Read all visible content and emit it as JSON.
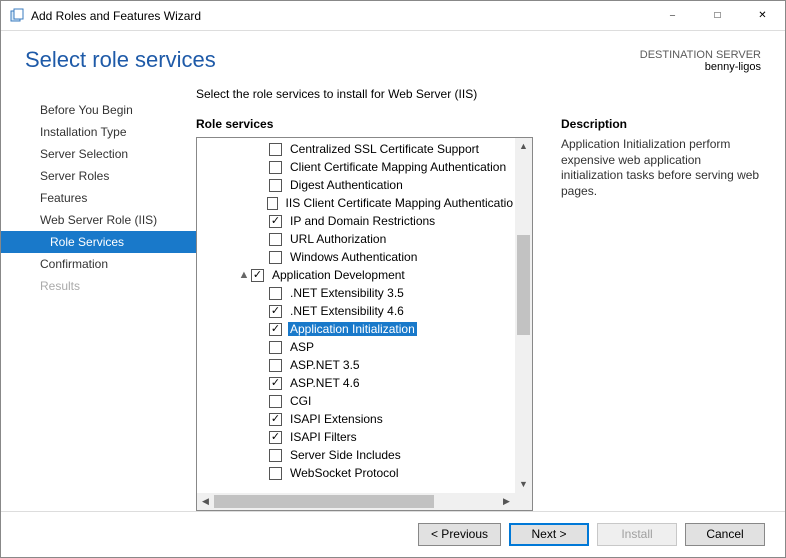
{
  "window": {
    "title": "Add Roles and Features Wizard"
  },
  "header": {
    "page_title": "Select role services",
    "destination_label": "DESTINATION SERVER",
    "destination_value": "benny-ligos"
  },
  "sidebar": {
    "items": [
      {
        "label": "Before You Begin"
      },
      {
        "label": "Installation Type"
      },
      {
        "label": "Server Selection"
      },
      {
        "label": "Server Roles"
      },
      {
        "label": "Features"
      },
      {
        "label": "Web Server Role (IIS)"
      },
      {
        "label": "Role Services",
        "selected": true,
        "sub": true
      },
      {
        "label": "Confirmation"
      },
      {
        "label": "Results",
        "disabled": true
      }
    ]
  },
  "main": {
    "instruction": "Select the role services to install for Web Server (IIS)",
    "role_services_label": "Role services",
    "description_label": "Description",
    "description_text": "Application Initialization perform expensive web application initialization tasks before serving web pages.",
    "selected_item": "Application Initialization",
    "tree": [
      {
        "indent": 3,
        "checked": false,
        "label": "Centralized SSL Certificate Support"
      },
      {
        "indent": 3,
        "checked": false,
        "label": "Client Certificate Mapping Authentication"
      },
      {
        "indent": 3,
        "checked": false,
        "label": "Digest Authentication"
      },
      {
        "indent": 3,
        "checked": false,
        "label": "IIS Client Certificate Mapping Authenticatio"
      },
      {
        "indent": 3,
        "checked": true,
        "label": "IP and Domain Restrictions"
      },
      {
        "indent": 3,
        "checked": false,
        "label": "URL Authorization"
      },
      {
        "indent": 3,
        "checked": false,
        "label": "Windows Authentication"
      },
      {
        "indent": 2,
        "checked": true,
        "label": "Application Development",
        "expander": "▲"
      },
      {
        "indent": 3,
        "checked": false,
        "label": ".NET Extensibility 3.5"
      },
      {
        "indent": 3,
        "checked": true,
        "label": ".NET Extensibility 4.6"
      },
      {
        "indent": 3,
        "checked": true,
        "label": "Application Initialization",
        "highlight": true
      },
      {
        "indent": 3,
        "checked": false,
        "label": "ASP"
      },
      {
        "indent": 3,
        "checked": false,
        "label": "ASP.NET 3.5"
      },
      {
        "indent": 3,
        "checked": true,
        "label": "ASP.NET 4.6"
      },
      {
        "indent": 3,
        "checked": false,
        "label": "CGI"
      },
      {
        "indent": 3,
        "checked": true,
        "label": "ISAPI Extensions"
      },
      {
        "indent": 3,
        "checked": true,
        "label": "ISAPI Filters"
      },
      {
        "indent": 3,
        "checked": false,
        "label": "Server Side Includes"
      },
      {
        "indent": 3,
        "checked": false,
        "label": "WebSocket Protocol"
      }
    ]
  },
  "footer": {
    "previous": "< Previous",
    "next": "Next >",
    "install": "Install",
    "cancel": "Cancel"
  }
}
